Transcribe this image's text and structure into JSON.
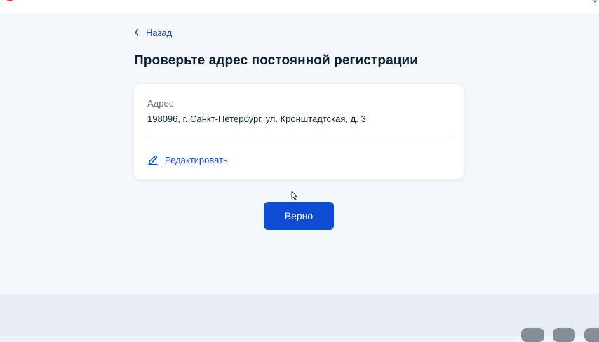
{
  "nav": {
    "back_label": "Назад"
  },
  "page": {
    "title": "Проверьте адрес постоянной регистрации"
  },
  "address_card": {
    "label": "Адрес",
    "value": "198096, г. Санкт-Петербург, ул. Кронштадтская, д. 3",
    "edit_label": "Редактировать"
  },
  "actions": {
    "confirm_label": "Верно"
  },
  "colors": {
    "accent": "#0d4cd3",
    "text": "#0b1f33",
    "muted": "#66727f",
    "page_bg": "#f4f8fc",
    "footer_bg": "#e8edf3"
  },
  "icons": {
    "back": "chevron-left-icon",
    "edit": "pencil-icon",
    "cursor": "mouse-pointer-icon"
  }
}
